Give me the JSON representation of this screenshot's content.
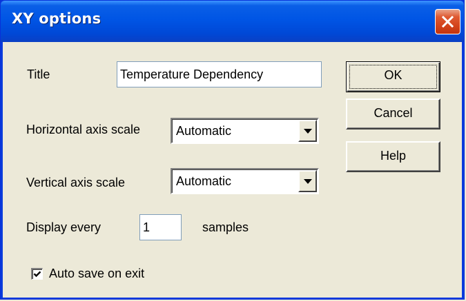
{
  "window": {
    "title": "XY options",
    "close_icon": "close-icon"
  },
  "form": {
    "title_label": "Title",
    "title_value": "Temperature Dependency",
    "horizontal_label": "Horizontal axis scale",
    "horizontal_value": "Automatic",
    "vertical_label": "Vertical axis scale",
    "vertical_value": "Automatic",
    "display_every_label": "Display every",
    "display_every_value": "1",
    "samples_label": "samples",
    "auto_save_label": "Auto save on exit",
    "auto_save_checked": true
  },
  "buttons": {
    "ok": "OK",
    "cancel": "Cancel",
    "help": "Help"
  },
  "colors": {
    "titlebar": "#0055e5",
    "close_button": "#d2421a",
    "dialog_face": "#ece9d8"
  }
}
